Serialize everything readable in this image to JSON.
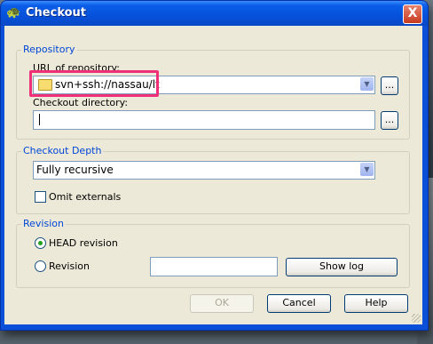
{
  "window": {
    "title": "Checkout",
    "close_label": "X"
  },
  "repository": {
    "group_label": "Repository",
    "url_label": "URL of repository:",
    "url_value": "svn+ssh://nassau/lt",
    "browse_url_label": "...",
    "dir_label": "Checkout directory:",
    "dir_value": "",
    "browse_dir_label": "..."
  },
  "depth": {
    "group_label": "Checkout Depth",
    "selected": "Fully recursive",
    "omit_externals_label": "Omit externals",
    "omit_externals_checked": false
  },
  "revision": {
    "group_label": "Revision",
    "head_label": "HEAD revision",
    "head_selected": true,
    "revision_label": "Revision",
    "revision_value": "",
    "show_log_label": "Show log"
  },
  "footer": {
    "ok_label": "OK",
    "cancel_label": "Cancel",
    "help_label": "Help"
  },
  "colors": {
    "title_bar": "#0a5ee8",
    "group_label": "#0046d5",
    "highlight": "#ef2f78"
  }
}
